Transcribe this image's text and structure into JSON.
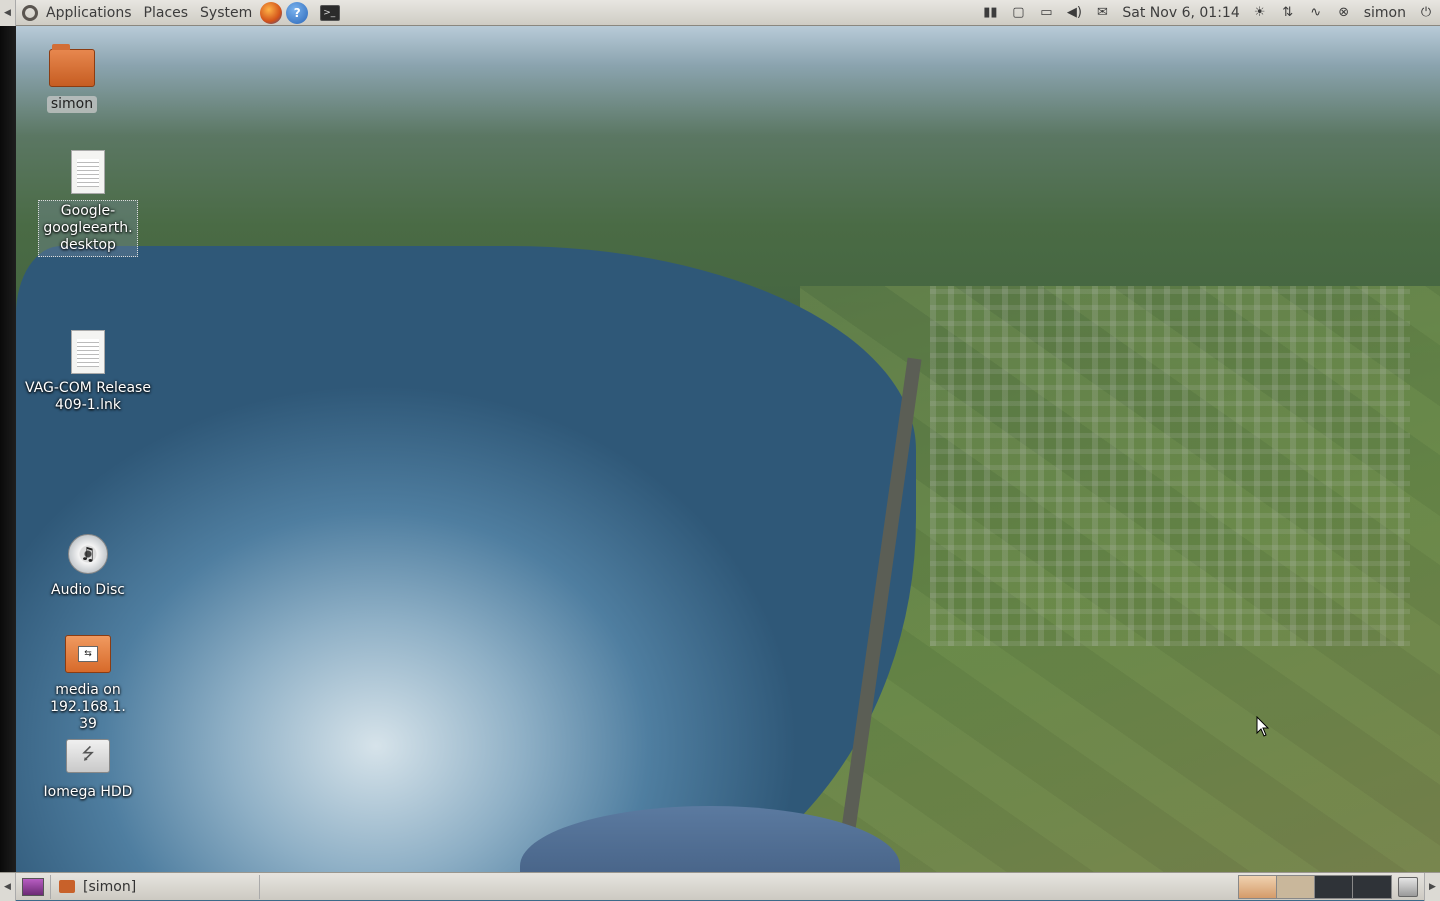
{
  "top_panel": {
    "menus": [
      "Applications",
      "Places",
      "System"
    ],
    "launchers": [
      "firefox-icon",
      "help-icon",
      "terminal-icon"
    ],
    "clock": "Sat Nov 6, 01:14",
    "user": "simon"
  },
  "desktop": {
    "icons": [
      {
        "label": "simon",
        "type": "folder"
      },
      {
        "label": "Google-googleearth.desktop",
        "label_lines": [
          "Google-",
          "googleearth.",
          "desktop"
        ],
        "type": "launcher-file"
      },
      {
        "label": "VAG-COM Release 409-1.lnk",
        "label_lines": [
          "VAG-COM Release",
          "409-1.lnk"
        ],
        "type": "document"
      },
      {
        "label": "Audio Disc",
        "type": "cd"
      },
      {
        "label": "media on 192.168.1.39",
        "label_lines": [
          "media on 192.168.1.",
          "39"
        ],
        "type": "network-share"
      },
      {
        "label": "Iomega HDD",
        "type": "usb-drive"
      }
    ]
  },
  "bottom_panel": {
    "task": "[simon]",
    "workspaces": 4
  }
}
